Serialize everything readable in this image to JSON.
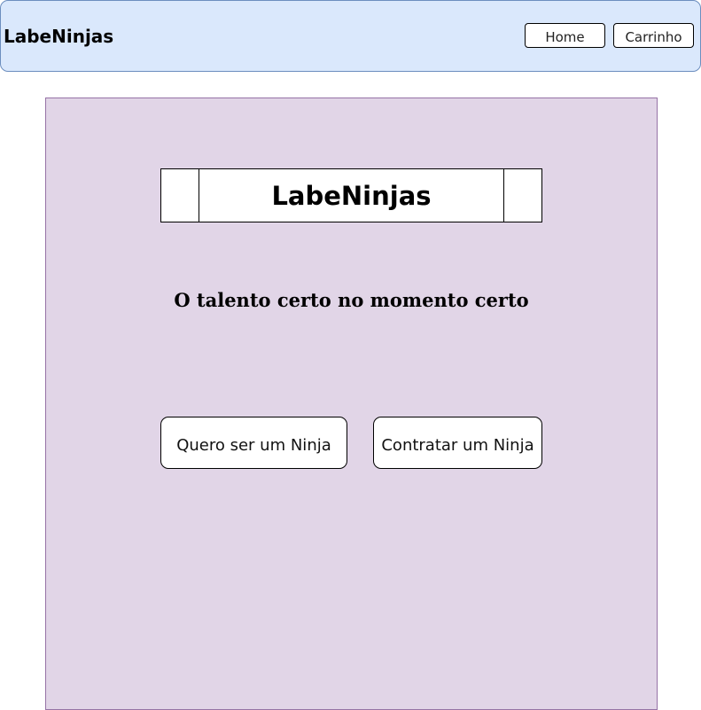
{
  "header": {
    "brand": "LabeNinjas",
    "nav": {
      "home_label": "Home",
      "cart_label": "Carrinho"
    }
  },
  "main": {
    "logo_text": "LabeNinjas",
    "tagline": "O talento certo no momento certo",
    "buttons": {
      "be_ninja_label": "Quero ser um Ninja",
      "hire_ninja_label": "Contratar um Ninja"
    }
  },
  "colors": {
    "header_bg": "#dae8fc",
    "header_border": "#6c8ebf",
    "panel_bg": "#e1d5e7",
    "panel_border": "#9673a6"
  }
}
